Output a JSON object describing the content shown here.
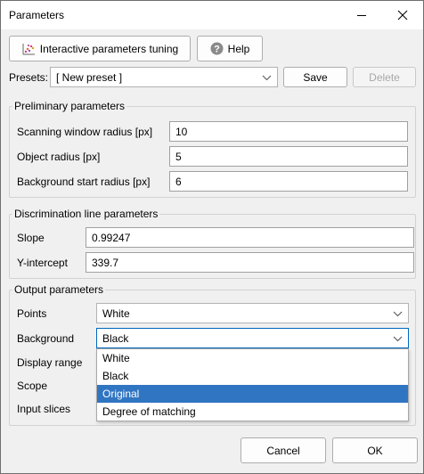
{
  "window": {
    "title": "Parameters"
  },
  "toolbar": {
    "interactive_tuning_label": "Interactive parameters tuning",
    "help_label": "Help"
  },
  "presets": {
    "label": "Presets:",
    "selected": "[ New preset ]",
    "save_label": "Save",
    "delete_label": "Delete"
  },
  "preliminary": {
    "title": "Preliminary parameters",
    "fields": [
      {
        "label": "Scanning window radius [px]",
        "value": "10"
      },
      {
        "label": "Object radius [px]",
        "value": "5"
      },
      {
        "label": "Background start radius [px]",
        "value": "6"
      }
    ]
  },
  "discrimination": {
    "title": "Discrimination line parameters",
    "fields": [
      {
        "label": "Slope",
        "value": "0.99247"
      },
      {
        "label": "Y-intercept",
        "value": "339.7"
      }
    ]
  },
  "output": {
    "title": "Output parameters",
    "points": {
      "label": "Points",
      "value": "White"
    },
    "background": {
      "label": "Background",
      "value": "Black"
    },
    "display_range_label": "Display range",
    "scope_label": "Scope",
    "input_slices_label": "Input slices",
    "dropdown_options": [
      "White",
      "Black",
      "Original",
      "Degree of matching"
    ],
    "dropdown_highlighted": "Original"
  },
  "footer": {
    "cancel_label": "Cancel",
    "ok_label": "OK"
  },
  "colors": {
    "highlight": "#3075c2",
    "focus_border": "#0067c0"
  }
}
